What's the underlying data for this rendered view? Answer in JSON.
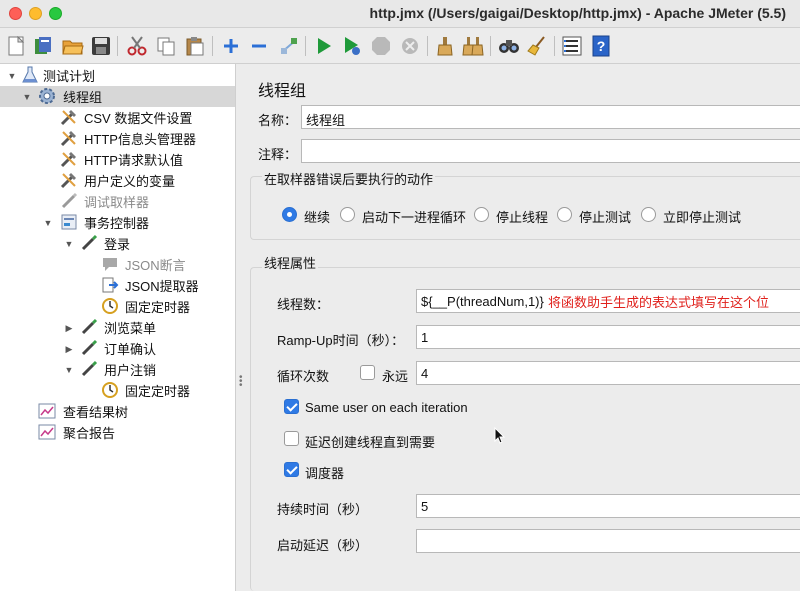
{
  "window": {
    "title": "http.jmx (/Users/gaigai/Desktop/http.jmx) - Apache JMeter (5.5)"
  },
  "toolbar": {
    "buttons": [
      "new-icon",
      "templates-icon",
      "open-icon",
      "save-icon",
      "cut-icon",
      "copy-icon",
      "paste-icon",
      "expand-icon",
      "collapse-icon",
      "toggle-icon",
      "start-icon",
      "start-no-pause-icon",
      "stop-icon",
      "shutdown-icon",
      "clear-icon",
      "clear-all-icon",
      "search-icon",
      "reset-search-icon",
      "function-helper-icon",
      "help-icon"
    ]
  },
  "tree": {
    "items": [
      {
        "label": "测试计划"
      },
      {
        "label": "线程组"
      },
      {
        "label": "CSV 数据文件设置"
      },
      {
        "label": "HTTP信息头管理器"
      },
      {
        "label": "HTTP请求默认值"
      },
      {
        "label": "用户定义的变量"
      },
      {
        "label": "调试取样器"
      },
      {
        "label": "事务控制器"
      },
      {
        "label": "登录"
      },
      {
        "label": "JSON断言"
      },
      {
        "label": "JSON提取器"
      },
      {
        "label": "固定定时器"
      },
      {
        "label": "浏览菜单"
      },
      {
        "label": "订单确认"
      },
      {
        "label": "用户注销"
      },
      {
        "label": "固定定时器"
      },
      {
        "label": "查看结果树"
      },
      {
        "label": "聚合报告"
      }
    ]
  },
  "panel": {
    "title": "线程组",
    "name_label": "名称：",
    "name_value": "线程组",
    "comment_label": "注释：",
    "comment_value": "",
    "error_action": {
      "title": "在取样器错误后要执行的动作",
      "options": [
        "继续",
        "启动下一进程循环",
        "停止线程",
        "停止测试",
        "立即停止测试"
      ],
      "selected": "继续"
    },
    "thread_props": {
      "title": "线程属性",
      "threads_label": "线程数：",
      "threads_value": "${__P(threadNum,1)}",
      "rampup_label": "Ramp-Up时间（秒）：",
      "rampup_value": "1",
      "loop_label": "循环次数",
      "forever_label": "永远",
      "forever_checked": false,
      "loop_value": "4",
      "same_user_label": "Same user on each iteration",
      "same_user_checked": true,
      "delay_label": "延迟创建线程直到需要",
      "delay_checked": false,
      "scheduler_label": "调度器",
      "scheduler_checked": true,
      "duration_label": "持续时间（秒）",
      "duration_value": "5",
      "startup_label": "启动延迟（秒）",
      "startup_value": ""
    },
    "annotation": "将函数助手生成的表达式填写在这个位"
  }
}
